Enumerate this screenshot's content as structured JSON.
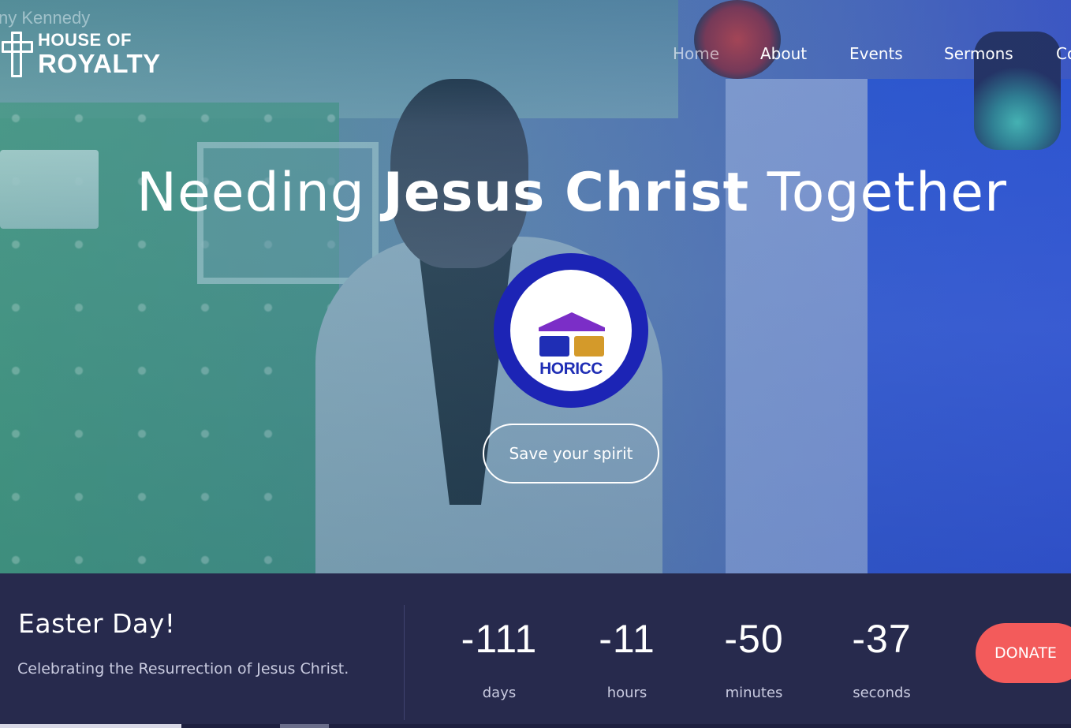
{
  "header": {
    "brand_overflow": "ny Kennedy",
    "logo_line1": "HOUSE OF",
    "logo_line2": "ROYALTY",
    "nav": [
      {
        "label": "Home"
      },
      {
        "label": "About"
      },
      {
        "label": "Events"
      },
      {
        "label": "Sermons"
      },
      {
        "label": "Co"
      }
    ]
  },
  "hero": {
    "headline_pre": "Needing ",
    "headline_bold": "Jesus Christ",
    "headline_post": " Together",
    "badge_text": "HORICC",
    "cta_label": "Save your spirit"
  },
  "event": {
    "title": "Easter Day!",
    "subtitle": "Celebrating the Resurrection of Jesus Christ."
  },
  "countdown": [
    {
      "value": "-111",
      "label": "days"
    },
    {
      "value": "-11",
      "label": "hours"
    },
    {
      "value": "-50",
      "label": "minutes"
    },
    {
      "value": "-37",
      "label": "seconds"
    }
  ],
  "donate_label": "DONATE",
  "colors": {
    "bar_bg": "#272a4d",
    "donate": "#f35b5b",
    "badge_ring": "#1c24b5"
  }
}
